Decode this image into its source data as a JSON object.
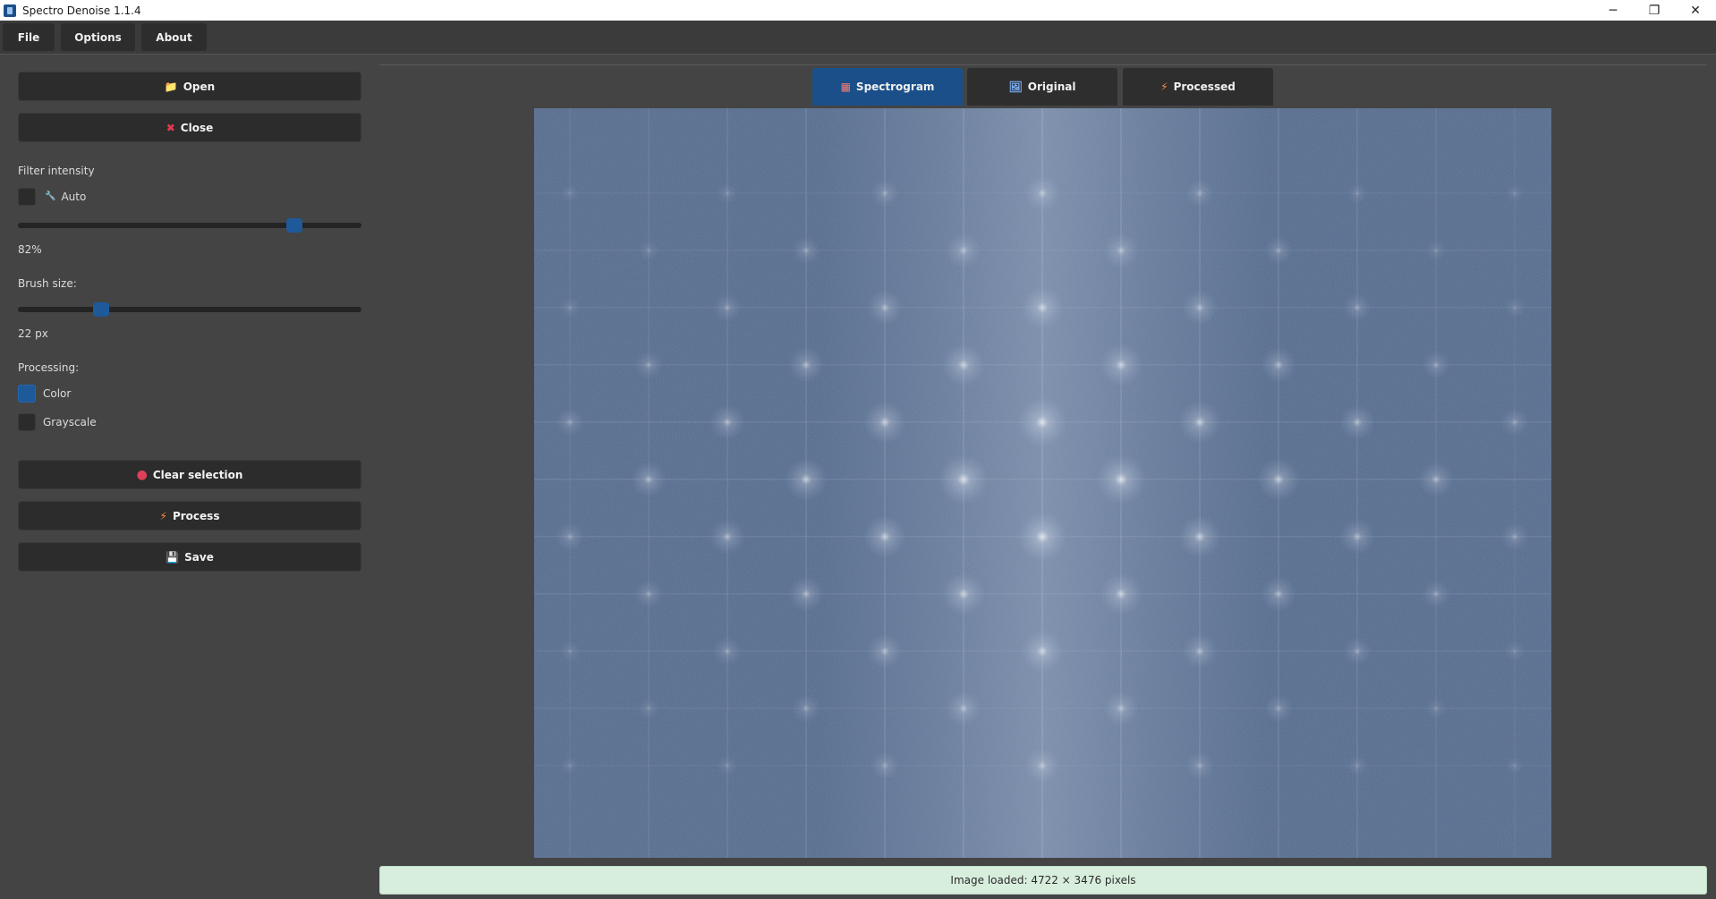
{
  "window": {
    "title": "Spectro Denoise 1.1.4",
    "minimize_glyph": "─",
    "maximize_glyph": "❐",
    "close_glyph": "✕"
  },
  "menu": {
    "items": [
      {
        "label": "File"
      },
      {
        "label": "Options"
      },
      {
        "label": "About"
      }
    ]
  },
  "sidebar": {
    "open_button": {
      "label": "Open",
      "icon": "folder-icon",
      "glyph": "📁"
    },
    "close_button": {
      "label": "Close",
      "icon": "close-icon",
      "glyph": "✖"
    },
    "filter_intensity": {
      "label": "Filter intensity",
      "auto_label": "Auto",
      "auto_icon": "wand-icon",
      "auto_glyph": "🔧",
      "auto_checked": false,
      "value": 82,
      "value_text": "82%"
    },
    "brush_size": {
      "label": "Brush size:",
      "value": 22,
      "value_fraction": 0.23,
      "value_text": "22 px"
    },
    "processing": {
      "label": "Processing:",
      "options": [
        {
          "label": "Color",
          "checked": true
        },
        {
          "label": "Grayscale",
          "checked": false
        }
      ]
    },
    "clear_button": {
      "label": "Clear selection",
      "icon": "red-dot-icon",
      "glyph": "●"
    },
    "process_button": {
      "label": "Process",
      "icon": "lightning-icon",
      "glyph": "⚡"
    },
    "save_button": {
      "label": "Save",
      "icon": "floppy-icon",
      "glyph": "💾"
    }
  },
  "tabs": [
    {
      "label": "Spectrogram",
      "icon": "spectrum-icon",
      "glyph": "▦",
      "active": true
    },
    {
      "label": "Original",
      "icon": "image-icon",
      "glyph": "🖼",
      "active": false
    },
    {
      "label": "Processed",
      "icon": "lightning-icon",
      "glyph": "⚡",
      "active": false
    }
  ],
  "status": {
    "text": "Image loaded: 4722 × 3476 pixels"
  },
  "colors": {
    "accent": "#1e5a9a",
    "tab_active": "#1a4f8a",
    "spectrum_base": "#566d90",
    "status_bg": "#d8eedd",
    "clear_dot": "#e0405a",
    "lightning": "#ff8a3d",
    "folder": "#f2b84b"
  }
}
